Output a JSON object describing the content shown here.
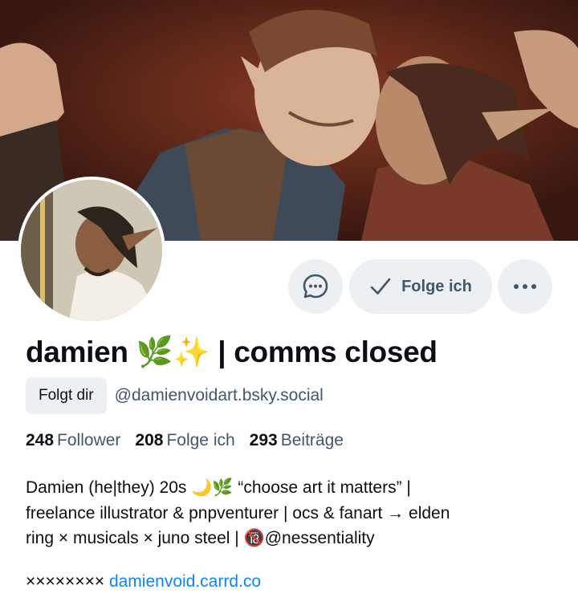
{
  "banner": {
    "alt": ""
  },
  "profile": {
    "display_name": "damien 🌿✨ | comms closed",
    "follows_you_badge": "Folgt dir",
    "handle": "@damienvoidart.bsky.social"
  },
  "actions": {
    "message_icon": "chat-bubble-icon",
    "follow_label": "Folge ich",
    "follow_icon": "checkmark-icon",
    "more_icon": "ellipsis-icon"
  },
  "stats": {
    "followers_count": "248",
    "followers_label": "Follower",
    "following_count": "208",
    "following_label": "Folge ich",
    "posts_count": "293",
    "posts_label": "Beiträge"
  },
  "bio": {
    "line1": "Damien (he|they) 20s 🌙🌿 “choose art it matters” |",
    "line2": "freelance illustrator & pnpventurer | ocs & fanart → elden",
    "line3_text": "ring × musicals × juno steel | ",
    "line3_mention": "🔞@nessentiality",
    "link_prefix": "××××××××",
    "link_text": "damienvoid.carrd.co"
  },
  "colors": {
    "button_bg": "#edf0f3",
    "secondary_text": "#42576c",
    "link": "#1083fe"
  }
}
